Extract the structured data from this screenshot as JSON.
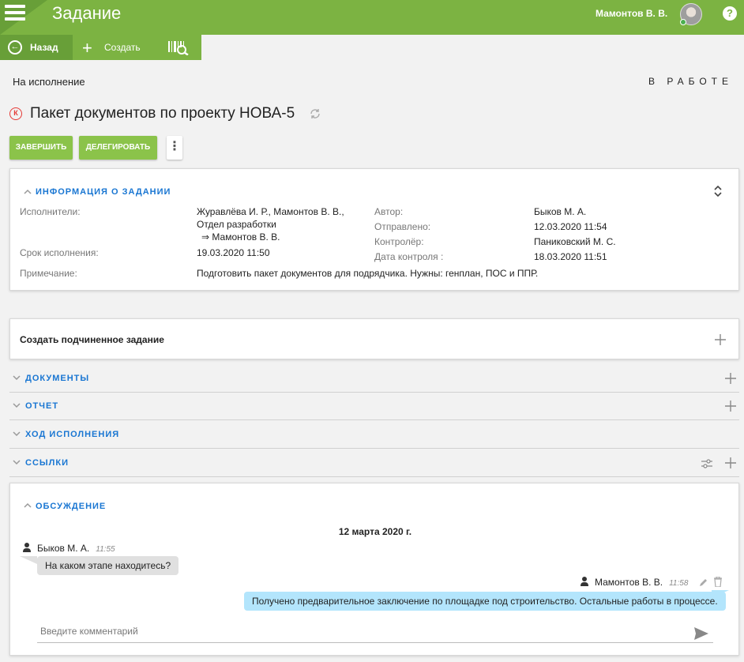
{
  "header": {
    "title": "Задание",
    "user_name": "Мамонтов В. В.",
    "help_label": "?"
  },
  "toolbar": {
    "back_label": "Назад",
    "create_label": "Создать"
  },
  "task": {
    "status_left": "На исполнение",
    "status_right": "В РАБОТЕ",
    "mark_letter": "К",
    "title": "Пакет документов по проекту НОВА-5",
    "buttons": {
      "finish": "ЗАВЕРШИТЬ",
      "delegate": "ДЕЛЕГИРОВАТЬ",
      "more": "⋮"
    }
  },
  "info": {
    "section_title": "ИНФОРМАЦИЯ О ЗАДАНИИ",
    "executors_label": "Исполнители:",
    "executors_line1": "Журавлёва И. Р., Мамонтов В. В.,",
    "executors_line2": "Отдел разработки",
    "executors_line3": "⇒  Мамонтов В. В.",
    "deadline_label": "Срок исполнения:",
    "deadline_value": "19.03.2020 11:50",
    "note_label": "Примечание:",
    "note_value": "Подготовить пакет документов для подрядчика. Нужны: генплан, ПОС и ППР.",
    "author_label": "Автор:",
    "author_value": "Быков М. А.",
    "sent_label": "Отправлено:",
    "sent_value": "12.03.2020 11:54",
    "controller_label": "Контролёр:",
    "controller_value": "Паниковский М. С.",
    "control_date_label": "Дата контроля :",
    "control_date_value": "18.03.2020 11:51"
  },
  "subtask": {
    "label": "Создать подчиненное задание"
  },
  "sections": {
    "documents": "ДОКУМЕНТЫ",
    "report": "ОТЧЕТ",
    "progress": "ХОД ИСПОЛНЕНИЯ",
    "links": "ССЫЛКИ"
  },
  "discussion": {
    "title": "ОБСУЖДЕНИЕ",
    "date": "12 марта 2020 г.",
    "messages": [
      {
        "author": "Быков М. А.",
        "time": "11:55",
        "text": "На каком этапе находитесь?"
      },
      {
        "author": "Мамонтов В. В.",
        "time": "11:58",
        "text": "Получено предварительное заключение по площадке под строительство. Остальные работы в процессе."
      }
    ],
    "comment_placeholder": "Введите комментарий"
  },
  "colors": {
    "brand_green": "#7cb342",
    "accent_blue": "#1976d2",
    "task_mark_red": "#e53935",
    "bubble_out": "#b3e5fc"
  }
}
